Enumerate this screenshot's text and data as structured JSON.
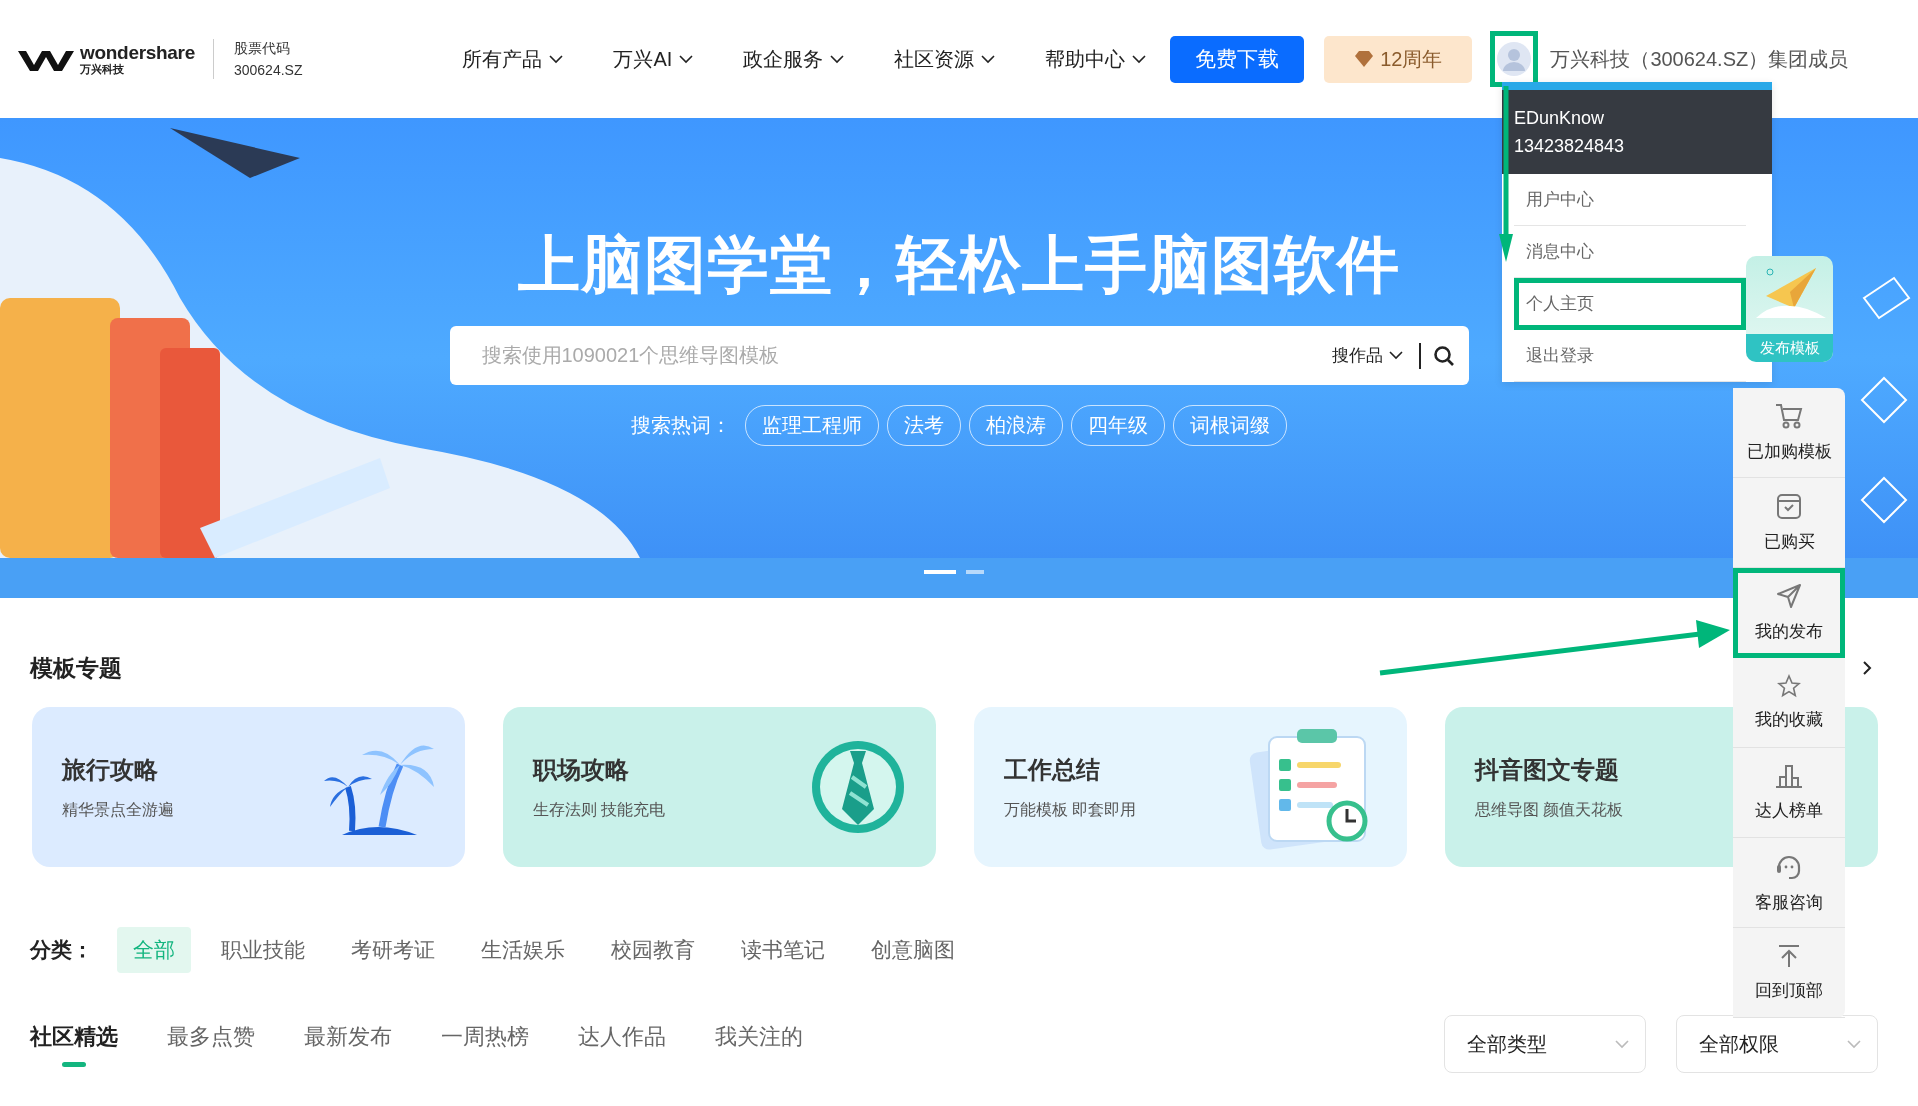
{
  "header": {
    "logo": {
      "brand": "wondershare",
      "sub": "万兴科技"
    },
    "stock": {
      "label": "股票代码",
      "code": "300624.SZ"
    },
    "nav": [
      {
        "label": "所有产品"
      },
      {
        "label": "万兴AI"
      },
      {
        "label": "政企服务"
      },
      {
        "label": "社区资源"
      },
      {
        "label": "帮助中心"
      }
    ],
    "download_button": "免费下载",
    "anniversary": "12周年",
    "avatar": {
      "highlighted": true
    },
    "group_text": "万兴科技（300624.SZ）集团成员"
  },
  "hero": {
    "title": "上脑图学堂，轻松上手脑图软件",
    "search": {
      "placeholder": "搜索使用1090021个思维导图模板",
      "scope": "搜作品"
    },
    "hot_label": "搜索热词：",
    "hot_words": [
      "监理工程师",
      "法考",
      "柏浪涛",
      "四年级",
      "词根词缀"
    ],
    "slides": [
      {
        "selected": true
      },
      {
        "selected": false
      }
    ]
  },
  "user_menu": {
    "username": "EDunKnow",
    "phone": "13423824843",
    "items": [
      {
        "label": "用户中心",
        "highlighted": false
      },
      {
        "label": "消息中心",
        "highlighted": false
      },
      {
        "label": "个人主页",
        "highlighted": true
      },
      {
        "label": "退出登录",
        "highlighted": false
      }
    ]
  },
  "publish_card": {
    "label": "发布模板"
  },
  "side_toolbar": {
    "items": [
      {
        "label": "已加购模板",
        "kind": "cart",
        "highlighted": false
      },
      {
        "label": "已购买",
        "kind": "bag",
        "highlighted": false
      },
      {
        "label": "我的发布",
        "kind": "send",
        "highlighted": true
      },
      {
        "label": "我的收藏",
        "kind": "star",
        "highlighted": false
      },
      {
        "label": "达人榜单",
        "kind": "chart",
        "highlighted": false
      },
      {
        "label": "客服咨询",
        "kind": "headset",
        "highlighted": false
      },
      {
        "label": "回到顶部",
        "kind": "top",
        "highlighted": false
      }
    ]
  },
  "topics": {
    "title": "模板专题",
    "cards": [
      {
        "title": "旅行攻略",
        "subtitle": "精华景点全游遍",
        "kind": "palm",
        "color": "#dcebff"
      },
      {
        "title": "职场攻略",
        "subtitle": "生存法则 技能充电",
        "kind": "tie",
        "color": "#c9f1ea"
      },
      {
        "title": "工作总结",
        "subtitle": "万能模板 即套即用",
        "kind": "clipboard",
        "color": "#e6f5fe"
      },
      {
        "title": "抖音图文专题",
        "subtitle": "思维导图 颜值天花板",
        "color": "#c9f1ea"
      }
    ]
  },
  "categories": {
    "label": "分类：",
    "items": [
      {
        "label": "全部",
        "selected": true
      },
      {
        "label": "职业技能",
        "selected": false
      },
      {
        "label": "考研考证",
        "selected": false
      },
      {
        "label": "生活娱乐",
        "selected": false
      },
      {
        "label": "校园教育",
        "selected": false
      },
      {
        "label": "读书笔记",
        "selected": false
      },
      {
        "label": "创意脑图",
        "selected": false
      }
    ]
  },
  "feed_tabs": [
    {
      "label": "社区精选",
      "selected": true
    },
    {
      "label": "最多点赞",
      "selected": false
    },
    {
      "label": "最新发布",
      "selected": false
    },
    {
      "label": "一周热榜",
      "selected": false
    },
    {
      "label": "达人作品",
      "selected": false
    },
    {
      "label": "我关注的",
      "selected": false
    }
  ],
  "filters": [
    {
      "label": "全部类型"
    },
    {
      "label": "全部权限"
    }
  ]
}
